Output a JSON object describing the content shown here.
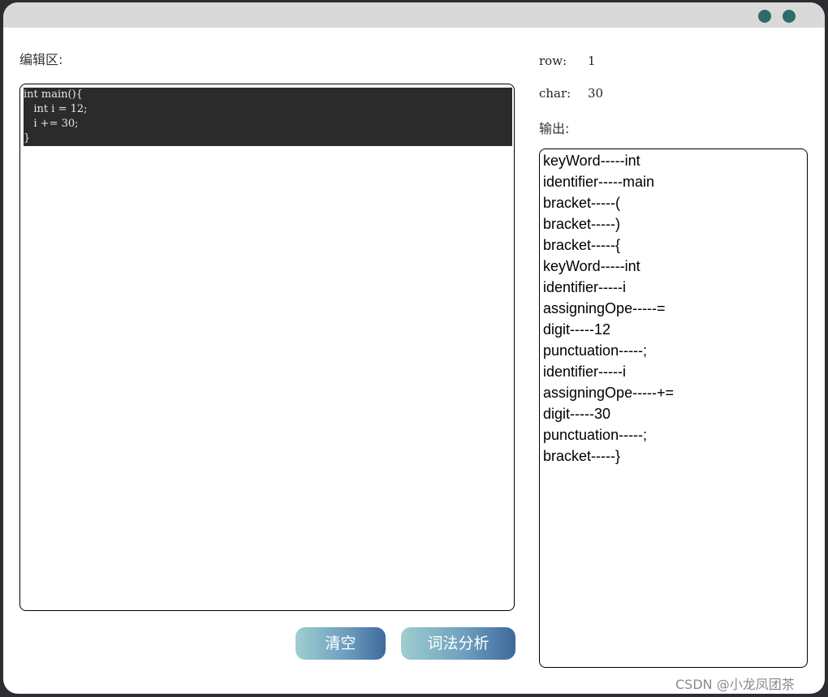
{
  "window": {
    "title_dots": [
      "window-dot",
      "window-dot"
    ]
  },
  "editor": {
    "label": "编辑区:",
    "code_lines": [
      "int main(){",
      "   int i = 12;",
      "   i += 30;",
      "}"
    ]
  },
  "cursor": {
    "row_label": "row:",
    "row_value": "1",
    "char_label": "char:",
    "char_value": "30"
  },
  "output": {
    "label": "输出:",
    "lines": [
      "keyWord-----int",
      "identifier-----main",
      "bracket-----(",
      "bracket-----)",
      "bracket-----{",
      "keyWord-----int",
      "identifier-----i",
      "assigningOpe-----=",
      "digit-----12",
      "punctuation-----;",
      "identifier-----i",
      "assigningOpe-----+=",
      "digit-----30",
      "punctuation-----;",
      "bracket-----}"
    ]
  },
  "buttons": {
    "clear_label": "清空",
    "analyze_label": "词法分析"
  },
  "watermark": "CSDN @小龙凤团茶",
  "colors": {
    "accent_dot": "#2e6b6b",
    "button_gradient_start": "#9ecfcf",
    "button_gradient_end": "#3d6a9c",
    "code_background": "#2b2b2b"
  }
}
